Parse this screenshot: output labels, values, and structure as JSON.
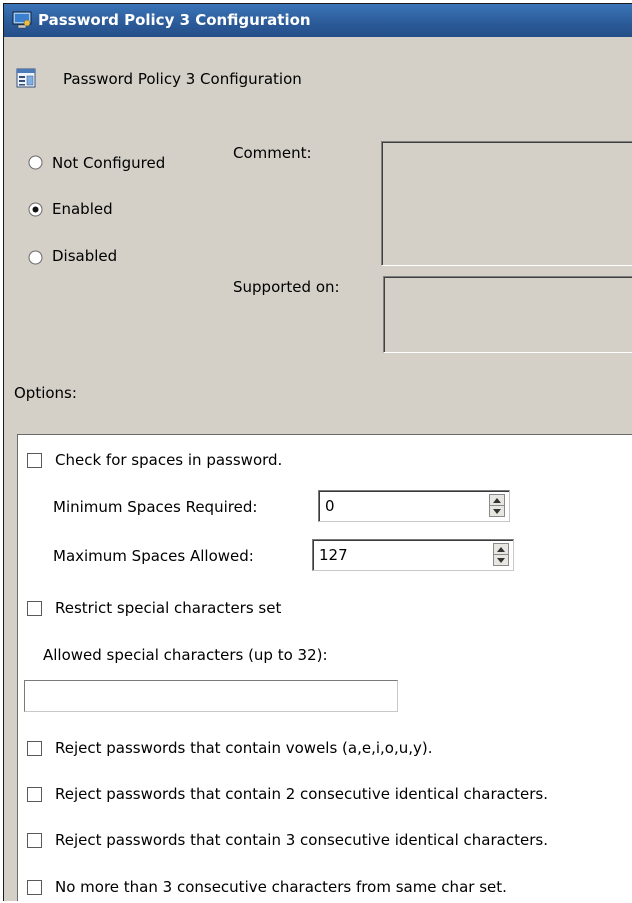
{
  "window": {
    "title": "Password Policy 3 Configuration"
  },
  "header": {
    "title": "Password Policy 3 Configuration",
    "icon": "policy-settings-icon"
  },
  "state": {
    "options": [
      {
        "label": "Not Configured",
        "selected": false
      },
      {
        "label": "Enabled",
        "selected": true
      },
      {
        "label": "Disabled",
        "selected": false
      }
    ]
  },
  "fields": {
    "comment_label": "Comment:",
    "comment_value": "",
    "supported_label": "Supported on:",
    "supported_value": ""
  },
  "options_label": "Options:",
  "options": {
    "check_spaces": {
      "label": "Check for spaces in password.",
      "checked": false
    },
    "min_spaces": {
      "label": "Minimum Spaces Required:",
      "value": "0"
    },
    "max_spaces": {
      "label": "Maximum Spaces Allowed:",
      "value": "127"
    },
    "restrict_special": {
      "label": "Restrict special characters set",
      "checked": false
    },
    "allowed_special": {
      "label": "Allowed special characters (up to 32):",
      "value": ""
    },
    "reject_vowels": {
      "label": "Reject passwords that contain vowels (a,e,i,o,u,y).",
      "checked": false
    },
    "reject_2_identical": {
      "label": "Reject passwords that contain 2 consecutive identical characters.",
      "checked": false
    },
    "reject_3_identical": {
      "label": "Reject passwords that contain 3 consecutive identical characters.",
      "checked": false
    },
    "consecutive_charset": {
      "label": "No more than 3 consecutive characters from same char set.",
      "checked": false
    }
  }
}
